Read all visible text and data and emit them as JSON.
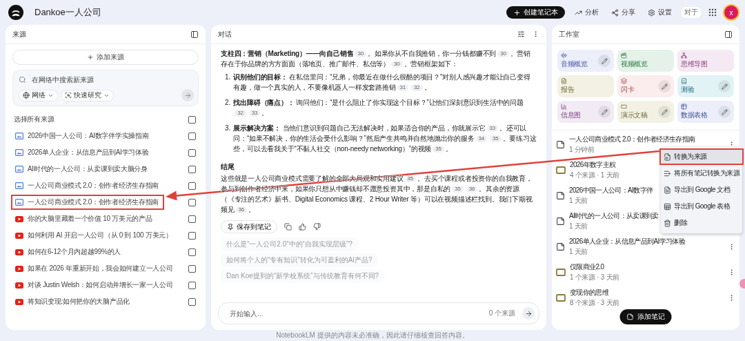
{
  "header": {
    "title": "Dankoe一人公司",
    "create_button": "创建笔记本",
    "actions": [
      {
        "kind": "analytics",
        "label": "分析"
      },
      {
        "kind": "share",
        "label": "分享"
      },
      {
        "kind": "settings",
        "label": "设置"
      }
    ],
    "badge": "对于",
    "avatar": "x"
  },
  "sources": {
    "title": "来源",
    "add_button": "添加来源",
    "search": {
      "placeholder": "在网络中搜索新来源",
      "chips": [
        {
          "kind": "web",
          "label": "网络"
        },
        {
          "kind": "research",
          "label": "快速研究"
        }
      ]
    },
    "select_all": {
      "label": "选择所有来源",
      "checked": false
    },
    "items": [
      {
        "kind": "doc",
        "title": "2026中国一人公司：AI数字伴学实操指南",
        "checked": false,
        "annotated": false
      },
      {
        "kind": "doc",
        "title": "2026单人企业：从信息产品到AI学习体验",
        "checked": false,
        "annotated": false
      },
      {
        "kind": "doc",
        "title": "AI时代的一人公司：从卖课到卖大脑分身",
        "checked": false,
        "annotated": false
      },
      {
        "kind": "doc",
        "title": "一人公司商业模式 2.0：创作者经济生存指南",
        "checked": false,
        "annotated": false
      },
      {
        "kind": "doc",
        "title": "一人公司商业模式 2.0：创作者经济生存指南",
        "checked": false,
        "annotated": true
      },
      {
        "kind": "youtube",
        "title": "你的大脑里藏着一个价值 10 万美元的产品",
        "checked": false,
        "annotated": false
      },
      {
        "kind": "youtube",
        "title": "如何利用 AI 开启一人公司（从 0 到 100 万美元）",
        "checked": false,
        "annotated": false
      },
      {
        "kind": "youtube",
        "title": "如何在6-12个月内超越99%的人",
        "checked": false,
        "annotated": false
      },
      {
        "kind": "youtube",
        "title": "如果在 2026 年重新开始，我会如何建立一人公司",
        "checked": false,
        "annotated": false
      },
      {
        "kind": "youtube",
        "title": "对谈 Justin Welsh：如何启动并增长一家一人公司",
        "checked": false,
        "annotated": false
      },
      {
        "kind": "youtube",
        "title": "将知识变现:如何把你的大脑产品化",
        "checked": false,
        "annotated": false
      }
    ]
  },
  "chat": {
    "title": "对话",
    "blocks": [
      {
        "kind": "para",
        "parts": [
          {
            "kind": "bold",
            "text": "支柱四：营销（Marketing）——向自己销售"
          },
          {
            "kind": "cite",
            "text": "30"
          },
          {
            "kind": "plain",
            "text": "。如果你从不自我推销，你一分钱都赚不到"
          },
          {
            "kind": "cite",
            "text": "30"
          },
          {
            "kind": "plain",
            "text": "。营销存在于你品牌的方方面面（落地页、推广邮件、私信等）"
          },
          {
            "kind": "cite",
            "text": "30"
          },
          {
            "kind": "plain",
            "text": "。营销框架如下："
          }
        ]
      },
      {
        "kind": "item",
        "number": "1.",
        "parts": [
          {
            "kind": "bold",
            "text": "识别他们的目标："
          },
          {
            "kind": "plain",
            "text": " 在私信里问：“兄弟，你最近在做什么很酷的项目？”对别人感兴趣才能让自己变得有趣，做一个真实的人，不要像机器人一样发套路推销"
          },
          {
            "kind": "cite",
            "text": "31"
          },
          {
            "kind": "cite",
            "text": "32"
          },
          {
            "kind": "plain",
            "text": "。"
          }
        ]
      },
      {
        "kind": "item",
        "number": "2.",
        "parts": [
          {
            "kind": "bold",
            "text": "找出障碍（痛点）："
          },
          {
            "kind": "plain",
            "text": " 询问他们：“是什么阻止了你实现这个目标？”让他们深刻意识到生活中的问题"
          },
          {
            "kind": "cite",
            "text": "32"
          },
          {
            "kind": "cite",
            "text": "33"
          },
          {
            "kind": "plain",
            "text": "。"
          }
        ]
      },
      {
        "kind": "item",
        "number": "3.",
        "parts": [
          {
            "kind": "bold",
            "text": "展示解决方案："
          },
          {
            "kind": "plain",
            "text": " 当他们意识到问题自己无法解决时，如果适合你的产品，你就展示它"
          },
          {
            "kind": "cite",
            "text": "33"
          },
          {
            "kind": "plain",
            "text": "。还可以问：“如果不解决，你的生活会受什么影响？”然后产生共鸣并自然地抛出你的服务"
          },
          {
            "kind": "cite",
            "text": "34"
          },
          {
            "kind": "cite",
            "text": "35"
          },
          {
            "kind": "plain",
            "text": "。要练习这些，可以去看我关于“不黏人社交（non-needy networking）”的视频"
          },
          {
            "kind": "cite",
            "text": "35"
          },
          {
            "kind": "plain",
            "text": "。"
          }
        ]
      },
      {
        "kind": "heading",
        "parts": [
          {
            "kind": "plain",
            "text": "结尾"
          }
        ]
      },
      {
        "kind": "para",
        "parts": [
          {
            "kind": "plain",
            "text": "这些就是一人公司商业模式需要了解的全部大局观和实用建议"
          },
          {
            "kind": "cite",
            "text": "35"
          },
          {
            "kind": "plain",
            "text": "。去买个课程或者投资你的自我教育，参与到创作者经济中来，如果你只想从中赚钱却不愿意投资其中，那是自私的"
          },
          {
            "kind": "cite",
            "text": "35"
          },
          {
            "kind": "cite",
            "text": "36"
          },
          {
            "kind": "plain",
            "text": "。其余的资源（《专注的艺术》新书、Digital Economics 课程、2 Hour Writer 等）可以在视频描述栏找到。我们下期视频见"
          },
          {
            "kind": "cite",
            "text": "36"
          },
          {
            "kind": "plain",
            "text": "。"
          }
        ]
      }
    ],
    "save_button": "保存到笔记",
    "suggestions": [
      "什么是“一人公司2.0”中的“自我实现层级”?",
      "如何将个人的“专有知识”转化为可盈利的AI产品?",
      "Dan Koe提到的“新学校系统”与传统教育有何不同?"
    ],
    "input": {
      "placeholder": "开始输入...",
      "source_count": "0 个来源"
    }
  },
  "studio": {
    "title": "工作室",
    "tiles": [
      {
        "kind": "audio",
        "label": "音频概览",
        "editable": true,
        "color": "#eceffa"
      },
      {
        "kind": "video",
        "label": "视频概览",
        "editable": false,
        "color": "#e5f2e9"
      },
      {
        "kind": "mindmap",
        "label": "思维导图",
        "editable": false,
        "color": "#f5eaf3"
      },
      {
        "kind": "report",
        "label": "报告",
        "editable": false,
        "color": "#f2f1e4"
      },
      {
        "kind": "flashcard",
        "label": "闪卡",
        "editable": true,
        "color": "#fbeced"
      },
      {
        "kind": "quiz",
        "label": "测验",
        "editable": true,
        "color": "#e2f3f6"
      },
      {
        "kind": "infographic",
        "label": "信息图",
        "editable": true,
        "color": "#f2ebf4"
      },
      {
        "kind": "slides",
        "label": "演示文稿",
        "editable": true,
        "color": "#f2f1e4"
      },
      {
        "kind": "table",
        "label": "数据表格",
        "editable": true,
        "color": "#eceffa"
      }
    ],
    "notes": [
      {
        "kind": "note",
        "title": "一人公司商业模式 2.0：创作者经济生存指南",
        "meta": "1 分钟前",
        "menu_open": true
      },
      {
        "kind": "notebook",
        "title": "2026年数字主权",
        "meta": "4 个来源 · 1 天前",
        "menu_open": false
      },
      {
        "kind": "note",
        "title": "2026中国一人公司：AI数字伴",
        "meta": "1 天前",
        "menu_open": false
      },
      {
        "kind": "note",
        "title": "AI时代的一人公司：从卖课到卖",
        "meta": "1 天前",
        "menu_open": false
      },
      {
        "kind": "note",
        "title": "2026单人企业：从信息产品到AI学习体验",
        "meta": "1 天前",
        "menu_open": false
      },
      {
        "kind": "notebook",
        "title": "仅限商业2.0",
        "meta": "1 个来源 · 3 天前",
        "menu_open": false
      },
      {
        "kind": "notebook",
        "title": "变现你的思维",
        "meta": "8 个来源 · 3 天前",
        "menu_open": false
      }
    ],
    "menu": [
      {
        "kind": "convert",
        "label": "转换为来源",
        "selected": true,
        "annotated": true
      },
      {
        "kind": "convert_all",
        "label": "将所有笔记转换为来源",
        "selected": false,
        "annotated": false
      },
      {
        "kind": "docs",
        "label": "导出到 Google 文档",
        "selected": false,
        "annotated": false
      },
      {
        "kind": "sheets",
        "label": "导出到 Google 表格",
        "selected": false,
        "annotated": false
      },
      {
        "kind": "delete",
        "label": "删除",
        "selected": false,
        "annotated": false
      }
    ],
    "add_note_button": "添加笔记"
  },
  "footer": "NotebookLM 提供的内容未必准确，因此请仔细核查回答内容。"
}
